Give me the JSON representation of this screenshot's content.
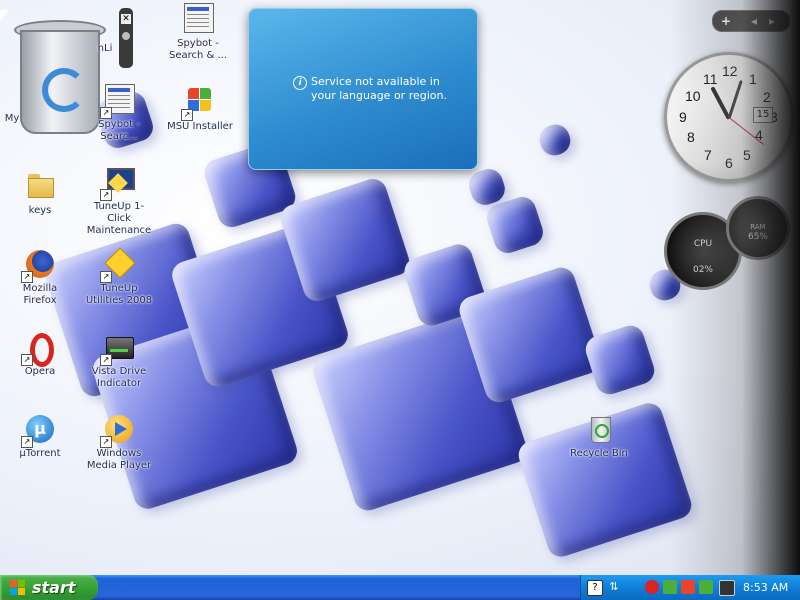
{
  "desktop": {
    "icons": [
      {
        "label": "My",
        "name": "my-computer"
      },
      {
        "label": "nLi",
        "name": "nlite"
      },
      {
        "label": "Spybot - Search & ...",
        "name": "spybot-1"
      },
      {
        "label": "Spybot - Searc...",
        "name": "spybot-2"
      },
      {
        "label": "MSU Installer",
        "name": "msu-installer"
      },
      {
        "label": "keys",
        "name": "keys-folder"
      },
      {
        "label": "TuneUp 1-Click Maintenance",
        "name": "tuneup-maintenance"
      },
      {
        "label": "Mozilla Firefox",
        "name": "firefox"
      },
      {
        "label": "TuneUp Utilities 2008",
        "name": "tuneup-utilities"
      },
      {
        "label": "Opera",
        "name": "opera"
      },
      {
        "label": "Vista Drive Indicator",
        "name": "vista-drive-indicator"
      },
      {
        "label": "µTorrent",
        "name": "utorrent"
      },
      {
        "label": "Windows Media Player",
        "name": "windows-media-player"
      },
      {
        "label": "Recycle Bin",
        "name": "recycle-bin"
      }
    ]
  },
  "popup": {
    "message": "Service not available in your language or region.",
    "icon": "info-icon"
  },
  "sidebar": {
    "controls": [
      "+",
      "◂",
      "▸"
    ]
  },
  "clock": {
    "numbers": [
      "12",
      "1",
      "2",
      "3",
      "4",
      "5",
      "6",
      "7",
      "8",
      "9",
      "10",
      "11"
    ],
    "date": "15",
    "time_shown": "8:53"
  },
  "meters": {
    "cpu_label": "CPU",
    "cpu_value": "02%",
    "ram_label": "RAM",
    "ram_value": "65%"
  },
  "taskbar": {
    "start_label": "start",
    "time": "8:53 AM"
  },
  "colors": {
    "taskbar": "#2566d8",
    "start": "#37a236",
    "popup": "#2f8cd0"
  }
}
